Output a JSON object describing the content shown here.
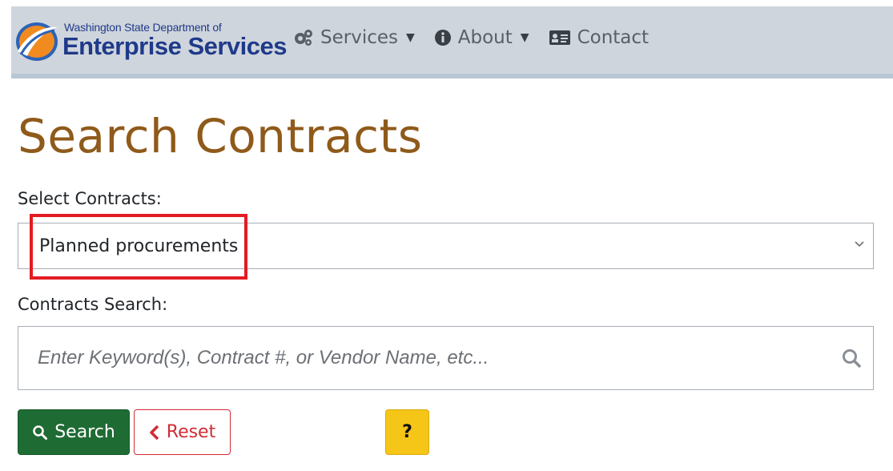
{
  "header": {
    "logo_top": "Washington State Department of",
    "logo_main": "Enterprise Services",
    "nav": [
      {
        "label": "Services",
        "icon": "gears-icon",
        "has_caret": true
      },
      {
        "label": "About",
        "icon": "info-circle-icon",
        "has_caret": true
      },
      {
        "label": "Contact",
        "icon": "contact-card-icon",
        "has_caret": false
      }
    ]
  },
  "page": {
    "title": "Search Contracts",
    "select_label": "Select Contracts:",
    "select_value": "Planned procurements",
    "search_label": "Contracts Search:",
    "search_placeholder": "Enter Keyword(s), Contract #, or Vendor Name, etc..."
  },
  "buttons": {
    "search": "Search",
    "reset": "Reset",
    "help": "?"
  },
  "colors": {
    "title": "#8f5a1a",
    "navbar_bg": "#cfd5dc",
    "search_button": "#1f6b34",
    "reset_button_border": "#d12c34",
    "help_button": "#f5c518",
    "highlight": "#e31b23"
  }
}
